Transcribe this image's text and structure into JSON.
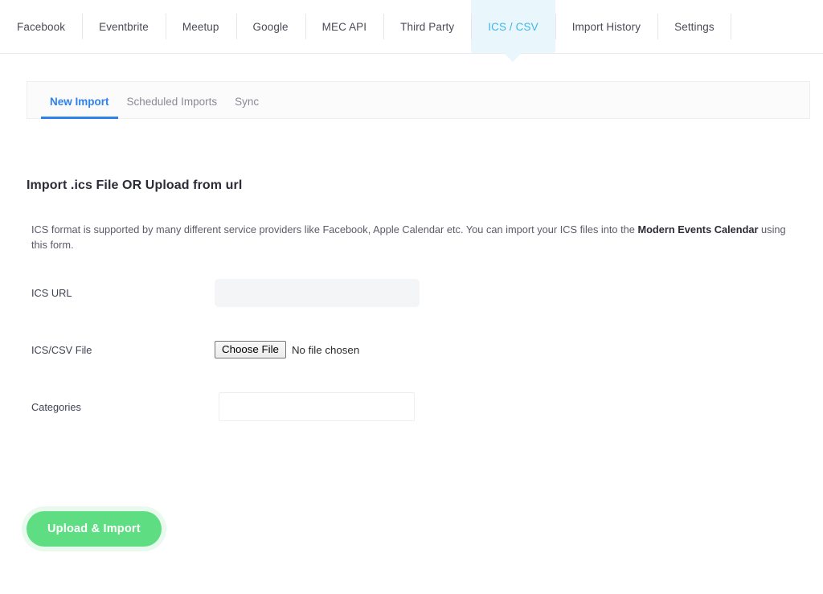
{
  "topnav": {
    "items": [
      {
        "label": "Facebook",
        "active": false
      },
      {
        "label": "Eventbrite",
        "active": false
      },
      {
        "label": "Meetup",
        "active": false
      },
      {
        "label": "Google",
        "active": false
      },
      {
        "label": "MEC API",
        "active": false
      },
      {
        "label": "Third Party",
        "active": false
      },
      {
        "label": "ICS / CSV",
        "active": true
      },
      {
        "label": "Import History",
        "active": false
      },
      {
        "label": "Settings",
        "active": false
      }
    ],
    "active_color": "#3fb6e8",
    "active_bg": "#e9f7fd"
  },
  "subtabs": {
    "items": [
      {
        "label": "New Import",
        "active": true
      },
      {
        "label": "Scheduled Imports",
        "active": false
      },
      {
        "label": "Sync",
        "active": false
      }
    ],
    "active_color": "#2f81ec"
  },
  "main": {
    "title": "Import .ics File OR Upload from url",
    "description": {
      "before": "ICS format is supported by many different service providers like Facebook, Apple Calendar etc. You can import your ICS files into the ",
      "strong": "Modern Events Calendar",
      "after": " using this form."
    },
    "fields": {
      "ics_url": {
        "label": "ICS URL",
        "value": "",
        "placeholder": ""
      },
      "ics_csv_file": {
        "label": "ICS/CSV File",
        "button_label": "Choose File",
        "status": "No file chosen"
      },
      "categories": {
        "label": "Categories",
        "value": "",
        "placeholder": ""
      }
    },
    "submit": {
      "label": "Upload & Import",
      "color": "#5fdd83"
    }
  }
}
